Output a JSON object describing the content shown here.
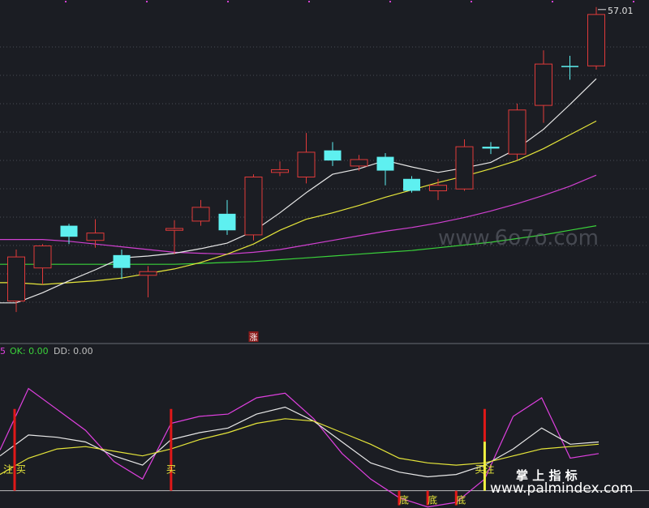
{
  "chart_data": [
    {
      "type": "candlestick",
      "title": "",
      "ylim": [
        20.9,
        57.6
      ],
      "price_label": "57.01",
      "colors": {
        "up": "#e03a3a",
        "down": "#5ef0f0",
        "ma_fast": "#e8e8e8",
        "ma_mid": "#e6e63a",
        "ma_slow": "#d040d0",
        "ma_long": "#3ad23a"
      },
      "candles": [
        {
          "o": 25.0,
          "h": 30.6,
          "l": 23.8,
          "c": 29.8
        },
        {
          "o": 28.6,
          "h": 31.2,
          "l": 26.8,
          "c": 31.0
        },
        {
          "o": 33.2,
          "h": 33.4,
          "l": 31.2,
          "c": 32.0
        },
        {
          "o": 31.6,
          "h": 33.9,
          "l": 30.8,
          "c": 32.4
        },
        {
          "o": 30.0,
          "h": 30.6,
          "l": 27.4,
          "c": 28.6
        },
        {
          "o": 27.8,
          "h": 28.8,
          "l": 25.4,
          "c": 28.2
        },
        {
          "o": 32.7,
          "h": 33.8,
          "l": 30.1,
          "c": 32.9
        },
        {
          "o": 33.7,
          "h": 36.0,
          "l": 33.2,
          "c": 35.2
        },
        {
          "o": 34.5,
          "h": 36.0,
          "l": 32.2,
          "c": 32.7
        },
        {
          "o": 32.2,
          "h": 38.8,
          "l": 31.6,
          "c": 38.5
        },
        {
          "o": 39.0,
          "h": 40.2,
          "l": 38.6,
          "c": 39.3
        },
        {
          "o": 38.5,
          "h": 43.3,
          "l": 37.8,
          "c": 41.2
        },
        {
          "o": 41.4,
          "h": 42.3,
          "l": 39.7,
          "c": 40.3
        },
        {
          "o": 39.7,
          "h": 40.9,
          "l": 39.2,
          "c": 40.4
        },
        {
          "o": 40.7,
          "h": 41.1,
          "l": 37.6,
          "c": 39.2
        },
        {
          "o": 38.3,
          "h": 38.6,
          "l": 36.8,
          "c": 37.0
        },
        {
          "o": 37.0,
          "h": 38.3,
          "l": 36.0,
          "c": 37.6
        },
        {
          "o": 37.2,
          "h": 42.6,
          "l": 37.0,
          "c": 41.8
        },
        {
          "o": 41.8,
          "h": 42.3,
          "l": 41.0,
          "c": 41.6
        },
        {
          "o": 41.0,
          "h": 46.5,
          "l": 40.4,
          "c": 45.8
        },
        {
          "o": 46.3,
          "h": 52.3,
          "l": 44.4,
          "c": 50.8
        },
        {
          "o": 50.6,
          "h": 51.7,
          "l": 49.1,
          "c": 50.5
        },
        {
          "o": 50.6,
          "h": 57.0,
          "l": 50.2,
          "c": 56.2
        }
      ],
      "ma_fast": [
        24.8,
        25.9,
        27.2,
        28.4,
        29.7,
        29.9,
        30.2,
        30.7,
        31.3,
        32.6,
        34.6,
        36.8,
        38.8,
        39.4,
        40.3,
        39.6,
        39.0,
        39.5,
        40.1,
        41.6,
        43.7,
        46.4,
        49.2
      ],
      "ma_mid": [
        27.0,
        26.8,
        27.0,
        27.2,
        27.5,
        28.0,
        28.5,
        29.2,
        30.1,
        31.2,
        32.7,
        33.9,
        34.6,
        35.4,
        36.3,
        37.1,
        37.9,
        38.6,
        39.4,
        40.3,
        41.6,
        43.1,
        44.6
      ],
      "ma_slow": [
        31.7,
        31.7,
        31.5,
        31.2,
        30.9,
        30.6,
        30.3,
        30.2,
        30.1,
        30.3,
        30.6,
        31.1,
        31.6,
        32.1,
        32.6,
        33.0,
        33.5,
        34.1,
        34.8,
        35.6,
        36.5,
        37.5,
        38.7
      ],
      "ma_long": [
        29.0,
        29.0,
        29.0,
        29.0,
        29.0,
        29.0,
        29.0,
        29.1,
        29.2,
        29.3,
        29.5,
        29.7,
        29.9,
        30.1,
        30.3,
        30.5,
        30.8,
        31.1,
        31.4,
        31.8,
        32.2,
        32.7,
        33.2
      ],
      "markers": [
        {
          "index": 9,
          "text": "涨"
        }
      ]
    },
    {
      "type": "line",
      "title": "",
      "legend": [
        {
          "label": "5",
          "color": "#e040e0"
        },
        {
          "label": "OK: 0.00",
          "color": "#3ad23a"
        },
        {
          "label": "DD: 0.00",
          "color": "#bfbfbf"
        }
      ],
      "ylim": [
        -10,
        110
      ],
      "series": [
        {
          "color": "#e040e0",
          "values": [
            35,
            88,
            70,
            52,
            25,
            10,
            58,
            64,
            66,
            80,
            84,
            62,
            32,
            10,
            -6,
            -14,
            -10,
            10,
            64,
            80,
            28,
            32
          ]
        },
        {
          "color": "#e8e8e8",
          "values": [
            30,
            48,
            46,
            42,
            30,
            22,
            44,
            50,
            54,
            66,
            72,
            60,
            42,
            24,
            16,
            12,
            14,
            22,
            36,
            54,
            40,
            42
          ]
        },
        {
          "color": "#e6e63a",
          "values": [
            14,
            28,
            36,
            38,
            34,
            30,
            36,
            44,
            50,
            58,
            62,
            60,
            50,
            40,
            28,
            24,
            22,
            24,
            30,
            36,
            38,
            40
          ]
        }
      ],
      "signals": [
        {
          "index": 0,
          "kind": "red",
          "height": 40,
          "label": "注 买",
          "label_color": "#e6e63a"
        },
        {
          "index": 6,
          "kind": "red",
          "height": 40,
          "label": "买",
          "label_color": "#e6e63a"
        },
        {
          "index": 17,
          "kind": "red-yellow",
          "height": 40,
          "label": "买注",
          "label_color": "#e6e63a"
        },
        {
          "index": 14,
          "kind": "red-short",
          "height": 4,
          "label": "底",
          "label_color": "#e6e63a"
        },
        {
          "index": 15,
          "kind": "red-short",
          "height": 4,
          "label": "底",
          "label_color": "#e6e63a"
        },
        {
          "index": 16,
          "kind": "red-short",
          "height": 4,
          "label": "底",
          "label_color": "#e6e63a"
        }
      ]
    }
  ],
  "watermarks": {
    "main": "www.6o7o.com",
    "bottom_cn": "掌 上 指 标",
    "bottom_url": "www.palmindex.com"
  }
}
